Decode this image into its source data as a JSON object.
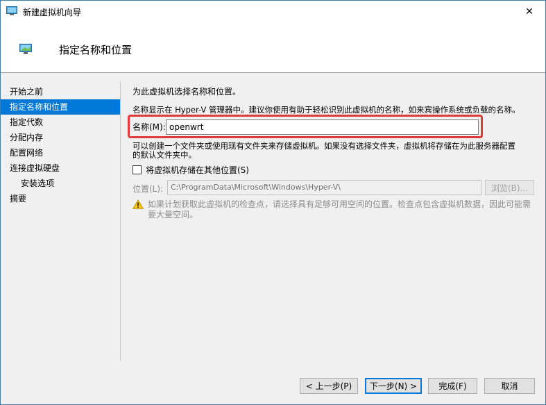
{
  "window": {
    "title": "新建虚拟机向导",
    "close_glyph": "✕"
  },
  "header": {
    "title": "指定名称和位置"
  },
  "nav": {
    "items": [
      {
        "label": "开始之前"
      },
      {
        "label": "指定名称和位置"
      },
      {
        "label": "指定代数"
      },
      {
        "label": "分配内存"
      },
      {
        "label": "配置网络"
      },
      {
        "label": "连接虚拟硬盘"
      },
      {
        "label": "安装选项"
      },
      {
        "label": "摘要"
      }
    ]
  },
  "content": {
    "intro": "为此虚拟机选择名称和位置。",
    "name_hint": "名称显示在 Hyper-V 管理器中。建议你使用有助于轻松识别此虚拟机的名称，如来宾操作系统或负载的名称。",
    "name_label": "名称(M):",
    "name_value": "openwrt",
    "folder_hint_line1": "可以创建一个文件夹或使用现有文件夹来存储虚拟机。如果没有选择文件夹，虚拟机将存储在为此服务器配置",
    "folder_hint_line2": "的默认文件夹中。",
    "store_elsewhere_label": "将虚拟机存储在其他位置(S)",
    "location_label": "位置(L):",
    "location_value": "C:\\ProgramData\\Microsoft\\Windows\\Hyper-V\\",
    "browse_label": "浏览(B)...",
    "warning_text": "如果计划获取此虚拟机的检查点，请选择具有足够可用空间的位置。检查点包含虚拟机数据，因此可能需要大量空间。"
  },
  "footer": {
    "prev_label": "< 上一步(P)",
    "next_label": "下一步(N) >",
    "finish_label": "完成(F)",
    "cancel_label": "取消"
  },
  "colors": {
    "accent": "#0078d7",
    "highlight": "#e03b3b",
    "warning": "#f0c419"
  }
}
